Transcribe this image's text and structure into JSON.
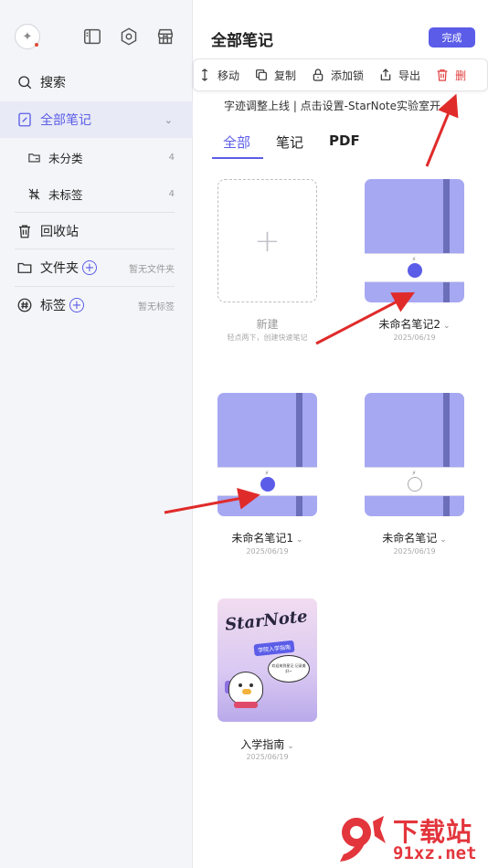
{
  "sidebar": {
    "avatar_icon": "sparkle-icon",
    "top_icons": [
      "sidebar-toggle-icon",
      "settings-hexagon-icon",
      "store-icon"
    ],
    "search_label": "搜索",
    "all_notes_label": "全部笔记",
    "unclassified_label": "未分类",
    "unclassified_count": "4",
    "untagged_label": "未标签",
    "untagged_count": "4",
    "trash_label": "回收站",
    "folders_label": "文件夹",
    "folders_empty": "暂无文件夹",
    "tags_label": "标签",
    "tags_empty": "暂无标签"
  },
  "header": {
    "title": "全部笔记",
    "done_label": "完成"
  },
  "toolbar": {
    "move_label": "移动",
    "copy_label": "复制",
    "lock_label": "添加锁",
    "export_label": "导出",
    "delete_label": "删"
  },
  "announcement": "字迹调整上线 | 点击设置-StarNote实验室开...",
  "tabs": {
    "all": "全部",
    "notes": "笔记",
    "pdf": "PDF"
  },
  "cards": {
    "new_label": "新建",
    "new_hint": "轻点两下，创建快速笔记",
    "note2_title": "未命名笔记2",
    "note2_date": "2025/06/19",
    "note1_title": "未命名笔记1",
    "note1_date": "2025/06/19",
    "note_title": "未命名笔记",
    "note_date": "2025/06/19",
    "guide_title": "入学指南",
    "guide_date": "2025/06/19",
    "guide_cover_logo": "StarNote",
    "guide_cover_tag": "学院入学指南",
    "guide_cover_bubble": "欢迎来到星记 记录美好~"
  },
  "colors": {
    "accent": "#5b5de8",
    "danger": "#e03c3c",
    "cover": "#a6a8f2",
    "annotation_arrow": "#e02b2b"
  },
  "watermark": {
    "brand": "下载站",
    "domain": "91xz.net"
  }
}
